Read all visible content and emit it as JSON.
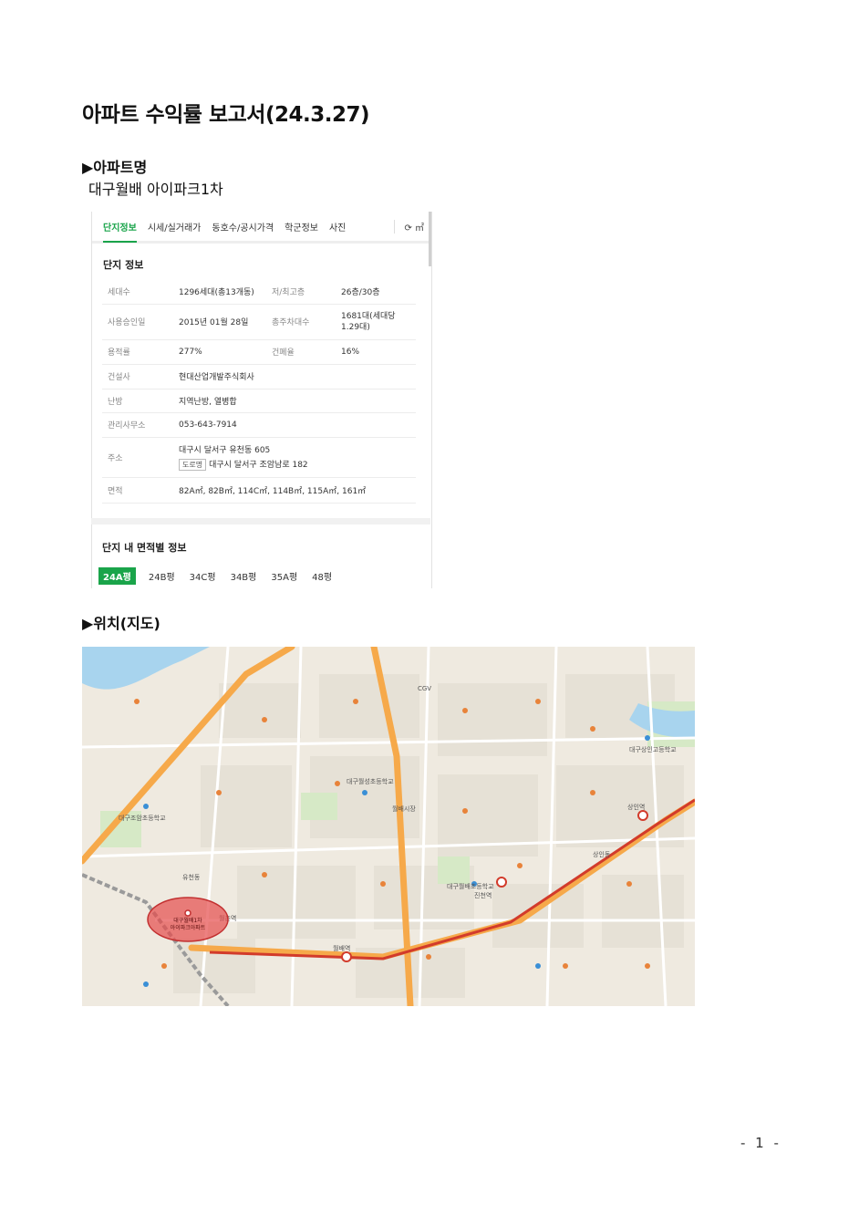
{
  "report": {
    "title": "아파트 수익률 보고서(24.3.27)",
    "apartment_heading": "▶아파트명",
    "apartment_name": "대구월배 아이파크1차",
    "location_heading": "▶위치(지도)",
    "page_number": "- 1 -"
  },
  "panel": {
    "tabs": [
      {
        "label": "단지정보",
        "active": true
      },
      {
        "label": "시세/실거래가",
        "active": false
      },
      {
        "label": "동호수/공시가격",
        "active": false
      },
      {
        "label": "학군정보",
        "active": false
      },
      {
        "label": "사진",
        "active": false
      }
    ],
    "refresh_label": "⟳ ㎡",
    "section_title": "단지 정보",
    "info_rows": [
      {
        "k1": "세대수",
        "v1": "1296세대(총13개동)",
        "k2": "저/최고층",
        "v2": "26층/30층"
      },
      {
        "k1": "사용승인일",
        "v1": "2015년 01월 28일",
        "k2": "총주차대수",
        "v2": "1681대(세대당 1.29대)"
      },
      {
        "k1": "용적률",
        "v1": "277%",
        "k2": "건폐율",
        "v2": "16%"
      }
    ],
    "builder_label": "건설사",
    "builder_value": "현대산업개발주식회사",
    "heating_label": "난방",
    "heating_value": "지역난방, 열병합",
    "office_label": "관리사무소",
    "office_value": "053-643-7914",
    "address_label": "주소",
    "address_lot": "대구시 달서구 유천동 605",
    "road_chip": "도로명",
    "address_road": "대구시 달서구 조암남로 182",
    "area_label": "면적",
    "area_value": "82A㎡, 82B㎡, 114C㎡, 114B㎡, 115A㎡, 161㎡",
    "area_section_title": "단지 내 면적별 정보",
    "area_tabs": [
      {
        "label": "24A평",
        "active": true
      },
      {
        "label": "24B평",
        "active": false
      },
      {
        "label": "34C평",
        "active": false
      },
      {
        "label": "34B평",
        "active": false
      },
      {
        "label": "35A평",
        "active": false
      },
      {
        "label": "48평",
        "active": false
      }
    ]
  },
  "map": {
    "highlight_label_1": "대구월배1차",
    "highlight_label_2": "아이파크아파트",
    "labels": [
      "월배역",
      "진천역",
      "상인역",
      "대구월배초등학교",
      "월촌역",
      "CGV",
      "대구월성초등학교",
      "월배시장",
      "상인동",
      "유천동",
      "대구조암초등학교",
      "대구상인고등학교"
    ],
    "colors": {
      "road_major": "#f6a94a",
      "rail": "#d23b2b",
      "water": "#a8d4ee",
      "green": "#d6e9c6",
      "highlight": "#e64b4b"
    }
  }
}
